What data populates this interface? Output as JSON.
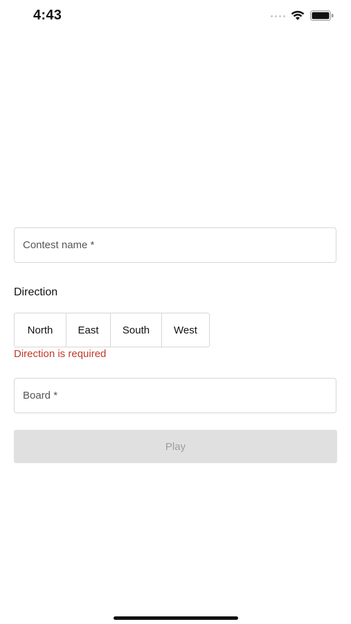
{
  "status_bar": {
    "time": "4:43"
  },
  "form": {
    "contest_name": {
      "placeholder": "Contest name *",
      "value": ""
    },
    "direction": {
      "label": "Direction",
      "options": [
        "North",
        "East",
        "South",
        "West"
      ],
      "error": "Direction is required"
    },
    "board": {
      "placeholder": "Board *",
      "value": ""
    },
    "play_label": "Play"
  },
  "colors": {
    "error": "#c0392b",
    "disabled_button_bg": "#e0e0e0",
    "disabled_button_text": "#9e9e9e",
    "border": "#d6d6d6"
  }
}
